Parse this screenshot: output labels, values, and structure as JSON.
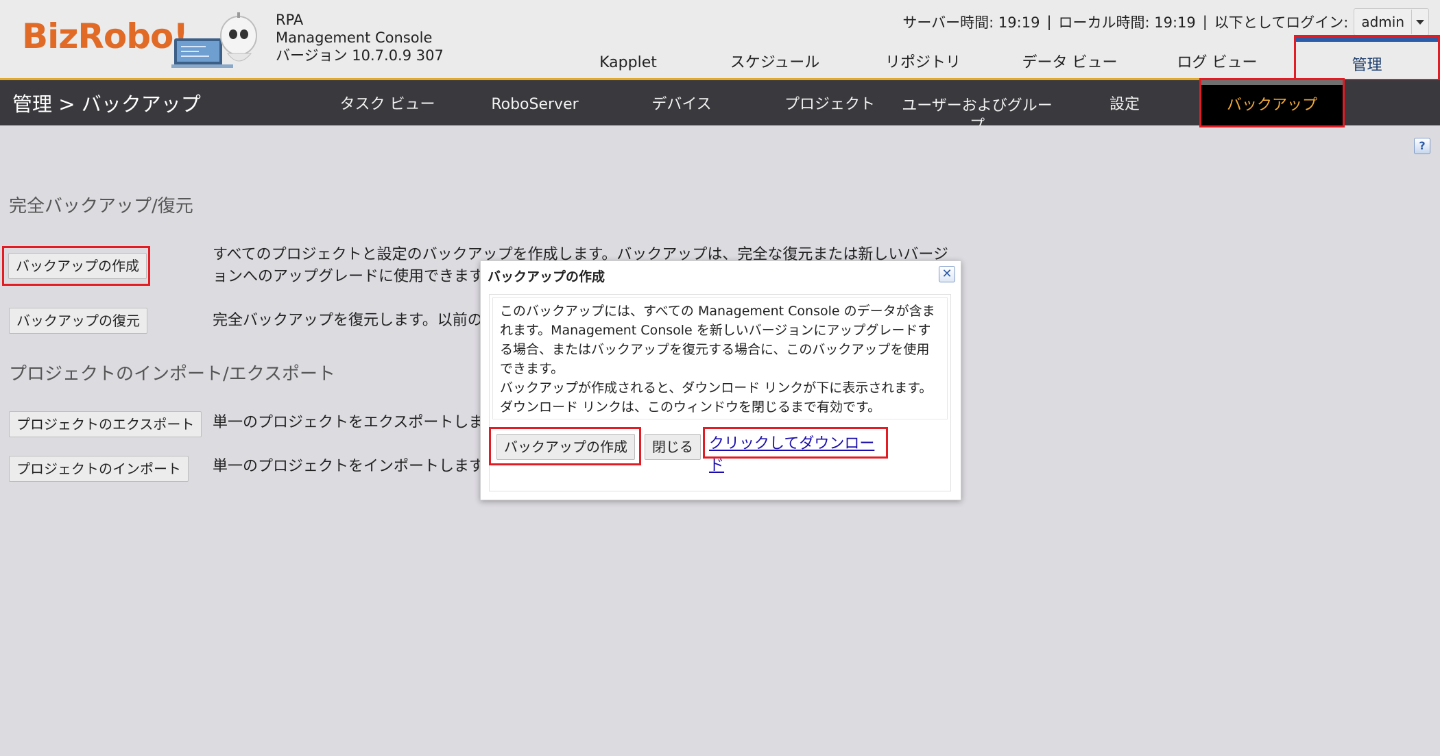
{
  "brand": {
    "logo_text": "BizRobo!"
  },
  "app": {
    "line1": "RPA",
    "line2": "Management Console",
    "line3": "バージョン 10.7.0.9 307"
  },
  "status": {
    "server_time": "サーバー時間: 19:19",
    "local_time": "ローカル時間: 19:19",
    "login_label": "以下としてログイン:",
    "user": "admin",
    "separator": "|"
  },
  "top_nav": {
    "kapplet": "Kapplet",
    "schedule": "スケジュール",
    "repository": "リポジトリ",
    "data_view": "データ ビュー",
    "log_view": "ログ ビュー",
    "admin": "管理"
  },
  "sub_nav": {
    "page_title": "管理 > バックアップ",
    "task_view": "タスク ビュー",
    "roboserver": "RoboServer",
    "devices": "デバイス",
    "projects": "プロジェクト",
    "users_groups": "ユーザーおよびグループ",
    "settings": "設定",
    "backup": "バックアップ"
  },
  "help": "?",
  "full_backup": {
    "title": "完全バックアップ/復元",
    "create_button": "バックアップの作成",
    "create_desc": "すべてのプロジェクトと設定のバックアップを作成します。バックアップは、完全な復元または新しいバージョンへのアップグレードに使用できます。",
    "restore_button": "バックアップの復元",
    "restore_desc": "完全バックアップを復元します。以前のバ"
  },
  "project_io": {
    "title": "プロジェクトのインポート/エクスポート",
    "export_button": "プロジェクトのエクスポート",
    "export_desc": "単一のプロジェクトをエクスポートします",
    "import_button": "プロジェクトのインポート",
    "import_desc": "単一のプロジェクトをインポートします。"
  },
  "dialog": {
    "title": "バックアップの作成",
    "close_icon": "✕",
    "message": "このバックアップには、すべての Management Console のデータが含まれます。Management Console を新しいバージョンにアップグレードする場合、またはバックアップを復元する場合に、このバックアップを使用できます。",
    "message2": "バックアップが作成されると、ダウンロード リンクが下に表示されます。ダウンロード リンクは、このウィンドウを閉じるまで有効です。",
    "create_button": "バックアップの作成",
    "close_button": "閉じる",
    "download_link": "クリックしてダウンロード"
  },
  "colors": {
    "highlight": "#e31b23",
    "header_accent": "#e2a92a",
    "admin_tab_bar": "#2b5ca8",
    "active_sub_tab_text": "#f0a93b",
    "logo": "#e06a26"
  }
}
